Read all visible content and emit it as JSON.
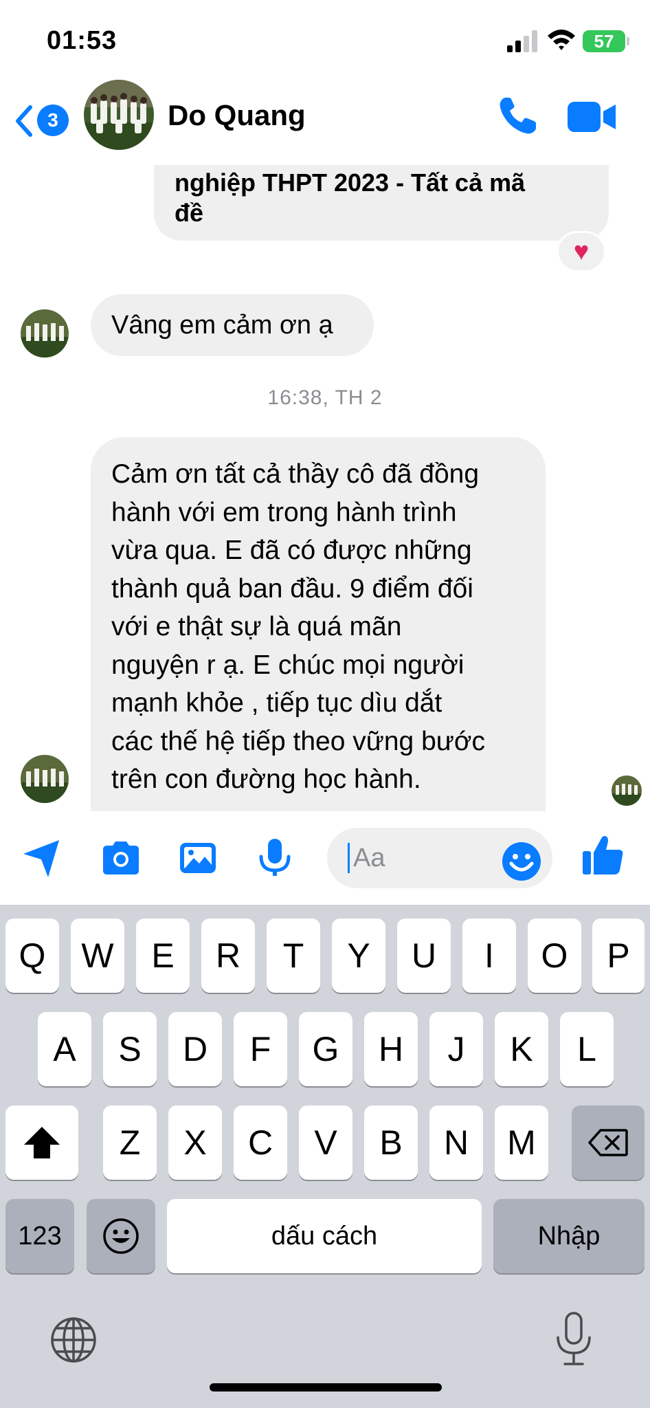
{
  "status_bar": {
    "time": "01:53",
    "battery": "57"
  },
  "header": {
    "unread_count": "3",
    "contact_name": "Do Quang"
  },
  "messages": {
    "previous_fragment": "nghiệp THPT 2023 - Tất cả mã\nđề",
    "reaction": "♥",
    "thanks": "Vâng em cảm ơn ạ",
    "timestamp": "16:38, TH 2",
    "long_message": "Cảm ơn tất cả thầy cô đã đồng\nhành với em trong hành trình\nvừa qua. E đã có được những\nthành quả ban đầu. 9 điểm đối\nvới e thật sự là quá mãn\nnguyện r ạ. E chúc mọi người\nmạnh khỏe , tiếp tục dìu dắt\ncác thế hệ tiếp theo vững bước\ntrên con đường học hành."
  },
  "composer": {
    "placeholder": "Aa"
  },
  "keyboard": {
    "row1": [
      "Q",
      "W",
      "E",
      "R",
      "T",
      "Y",
      "U",
      "I",
      "O",
      "P"
    ],
    "row2": [
      "A",
      "S",
      "D",
      "F",
      "G",
      "H",
      "J",
      "K",
      "L"
    ],
    "row3": [
      "Z",
      "X",
      "C",
      "V",
      "B",
      "N",
      "M"
    ],
    "numbers_key": "123",
    "space_key": "dấu cách",
    "return_key": "Nhập"
  },
  "colors": {
    "accent": "#0a7cff",
    "bubble": "#efefef",
    "keyboard_bg": "#d1d4da"
  },
  "icons": [
    "back-chevron-icon",
    "phone-icon",
    "video-camera-icon",
    "send-location-icon",
    "camera-icon",
    "gallery-icon",
    "microphone-icon",
    "emoji-icon",
    "thumbs-up-icon",
    "shift-icon",
    "backspace-icon",
    "globe-icon",
    "dictation-mic-icon"
  ]
}
